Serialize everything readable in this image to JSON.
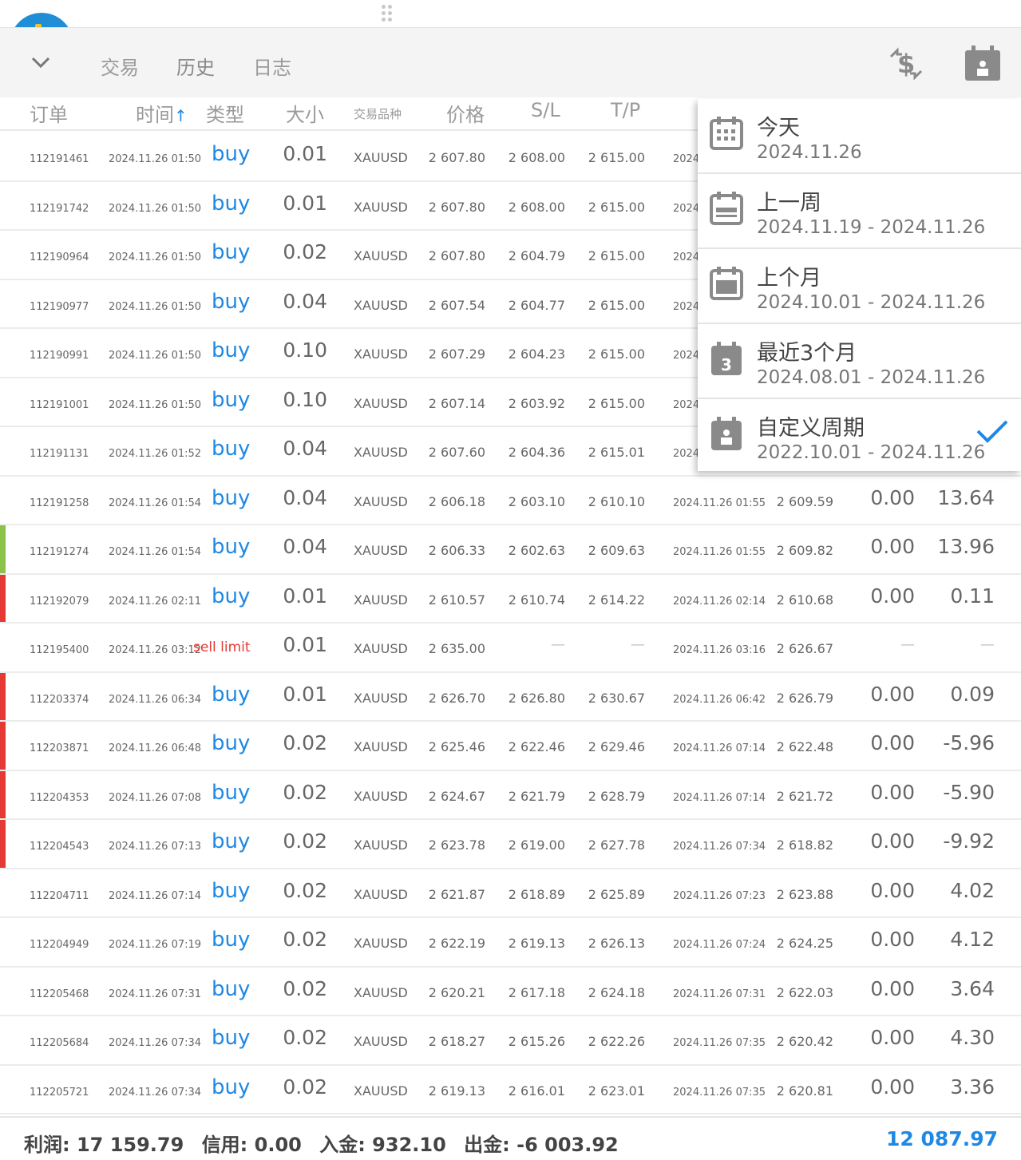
{
  "toolbar": {
    "tabs": [
      "交易",
      "历史",
      "日志"
    ]
  },
  "columns": {
    "order": "订单",
    "time": "时间",
    "type": "类型",
    "size": "大小",
    "symbol": "交易品种",
    "price": "价格",
    "sl": "S/L",
    "tp": "T/P"
  },
  "rows": [
    {
      "order": "112191461",
      "time": "2024.11.26 01:50",
      "type": "buy",
      "size": "0.01",
      "symbol": "XAUUSD",
      "price": "2 607.80",
      "sl": "2 608.00",
      "tp": "2 615.00",
      "close_time": "2024",
      "close_price": "",
      "swap": "",
      "profit": "",
      "marker": ""
    },
    {
      "order": "112191742",
      "time": "2024.11.26 01:50",
      "type": "buy",
      "size": "0.01",
      "symbol": "XAUUSD",
      "price": "2 607.80",
      "sl": "2 608.00",
      "tp": "2 615.00",
      "close_time": "2024",
      "close_price": "",
      "swap": "",
      "profit": "",
      "marker": ""
    },
    {
      "order": "112190964",
      "time": "2024.11.26 01:50",
      "type": "buy",
      "size": "0.02",
      "symbol": "XAUUSD",
      "price": "2 607.80",
      "sl": "2 604.79",
      "tp": "2 615.00",
      "close_time": "2024",
      "close_price": "",
      "swap": "",
      "profit": "",
      "marker": ""
    },
    {
      "order": "112190977",
      "time": "2024.11.26 01:50",
      "type": "buy",
      "size": "0.04",
      "symbol": "XAUUSD",
      "price": "2 607.54",
      "sl": "2 604.77",
      "tp": "2 615.00",
      "close_time": "2024",
      "close_price": "",
      "swap": "",
      "profit": "",
      "marker": ""
    },
    {
      "order": "112190991",
      "time": "2024.11.26 01:50",
      "type": "buy",
      "size": "0.10",
      "symbol": "XAUUSD",
      "price": "2 607.29",
      "sl": "2 604.23",
      "tp": "2 615.00",
      "close_time": "2024",
      "close_price": "",
      "swap": "",
      "profit": "",
      "marker": ""
    },
    {
      "order": "112191001",
      "time": "2024.11.26 01:50",
      "type": "buy",
      "size": "0.10",
      "symbol": "XAUUSD",
      "price": "2 607.14",
      "sl": "2 603.92",
      "tp": "2 615.00",
      "close_time": "2024",
      "close_price": "",
      "swap": "",
      "profit": "",
      "marker": ""
    },
    {
      "order": "112191131",
      "time": "2024.11.26 01:52",
      "type": "buy",
      "size": "0.04",
      "symbol": "XAUUSD",
      "price": "2 607.60",
      "sl": "2 604.36",
      "tp": "2 615.01",
      "close_time": "2024",
      "close_price": "",
      "swap": "",
      "profit": "",
      "marker": ""
    },
    {
      "order": "112191258",
      "time": "2024.11.26 01:54",
      "type": "buy",
      "size": "0.04",
      "symbol": "XAUUSD",
      "price": "2 606.18",
      "sl": "2 603.10",
      "tp": "2 610.10",
      "close_time": "2024.11.26 01:55",
      "close_price": "2 609.59",
      "swap": "0.00",
      "profit": "13.64",
      "marker": ""
    },
    {
      "order": "112191274",
      "time": "2024.11.26 01:54",
      "type": "buy",
      "size": "0.04",
      "symbol": "XAUUSD",
      "price": "2 606.33",
      "sl": "2 602.63",
      "tp": "2 609.63",
      "close_time": "2024.11.26 01:55",
      "close_price": "2 609.82",
      "swap": "0.00",
      "profit": "13.96",
      "marker": "#8bc34a"
    },
    {
      "order": "112192079",
      "time": "2024.11.26 02:11",
      "type": "buy",
      "size": "0.01",
      "symbol": "XAUUSD",
      "price": "2 610.57",
      "sl": "2 610.74",
      "tp": "2 614.22",
      "close_time": "2024.11.26 02:14",
      "close_price": "2 610.68",
      "swap": "0.00",
      "profit": "0.11",
      "marker": "#e53935"
    },
    {
      "order": "112195400",
      "time": "2024.11.26 03:12",
      "type": "sell limit",
      "size": "0.01",
      "symbol": "XAUUSD",
      "price": "2 635.00",
      "sl": "—",
      "tp": "—",
      "close_time": "2024.11.26 03:16",
      "close_price": "2 626.67",
      "swap": "—",
      "profit": "—",
      "marker": ""
    },
    {
      "order": "112203374",
      "time": "2024.11.26 06:34",
      "type": "buy",
      "size": "0.01",
      "symbol": "XAUUSD",
      "price": "2 626.70",
      "sl": "2 626.80",
      "tp": "2 630.67",
      "close_time": "2024.11.26 06:42",
      "close_price": "2 626.79",
      "swap": "0.00",
      "profit": "0.09",
      "marker": "#e53935"
    },
    {
      "order": "112203871",
      "time": "2024.11.26 06:48",
      "type": "buy",
      "size": "0.02",
      "symbol": "XAUUSD",
      "price": "2 625.46",
      "sl": "2 622.46",
      "tp": "2 629.46",
      "close_time": "2024.11.26 07:14",
      "close_price": "2 622.48",
      "swap": "0.00",
      "profit": "-5.96",
      "marker": "#e53935"
    },
    {
      "order": "112204353",
      "time": "2024.11.26 07:08",
      "type": "buy",
      "size": "0.02",
      "symbol": "XAUUSD",
      "price": "2 624.67",
      "sl": "2 621.79",
      "tp": "2 628.79",
      "close_time": "2024.11.26 07:14",
      "close_price": "2 621.72",
      "swap": "0.00",
      "profit": "-5.90",
      "marker": "#e53935"
    },
    {
      "order": "112204543",
      "time": "2024.11.26 07:13",
      "type": "buy",
      "size": "0.02",
      "symbol": "XAUUSD",
      "price": "2 623.78",
      "sl": "2 619.00",
      "tp": "2 627.78",
      "close_time": "2024.11.26 07:34",
      "close_price": "2 618.82",
      "swap": "0.00",
      "profit": "-9.92",
      "marker": "#e53935"
    },
    {
      "order": "112204711",
      "time": "2024.11.26 07:14",
      "type": "buy",
      "size": "0.02",
      "symbol": "XAUUSD",
      "price": "2 621.87",
      "sl": "2 618.89",
      "tp": "2 625.89",
      "close_time": "2024.11.26 07:23",
      "close_price": "2 623.88",
      "swap": "0.00",
      "profit": "4.02",
      "marker": ""
    },
    {
      "order": "112204949",
      "time": "2024.11.26 07:19",
      "type": "buy",
      "size": "0.02",
      "symbol": "XAUUSD",
      "price": "2 622.19",
      "sl": "2 619.13",
      "tp": "2 626.13",
      "close_time": "2024.11.26 07:24",
      "close_price": "2 624.25",
      "swap": "0.00",
      "profit": "4.12",
      "marker": ""
    },
    {
      "order": "112205468",
      "time": "2024.11.26 07:31",
      "type": "buy",
      "size": "0.02",
      "symbol": "XAUUSD",
      "price": "2 620.21",
      "sl": "2 617.18",
      "tp": "2 624.18",
      "close_time": "2024.11.26 07:31",
      "close_price": "2 622.03",
      "swap": "0.00",
      "profit": "3.64",
      "marker": ""
    },
    {
      "order": "112205684",
      "time": "2024.11.26 07:34",
      "type": "buy",
      "size": "0.02",
      "symbol": "XAUUSD",
      "price": "2 618.27",
      "sl": "2 615.26",
      "tp": "2 622.26",
      "close_time": "2024.11.26 07:35",
      "close_price": "2 620.42",
      "swap": "0.00",
      "profit": "4.30",
      "marker": ""
    },
    {
      "order": "112205721",
      "time": "2024.11.26 07:34",
      "type": "buy",
      "size": "0.02",
      "symbol": "XAUUSD",
      "price": "2 619.13",
      "sl": "2 616.01",
      "tp": "2 623.01",
      "close_time": "2024.11.26 07:35",
      "close_price": "2 620.81",
      "swap": "0.00",
      "profit": "3.36",
      "marker": ""
    }
  ],
  "footer": {
    "profit": "利润: 17 159.79",
    "credit": "信用: 0.00",
    "deposit": "入金: 932.10",
    "withdrawal": "出金: -6 003.92",
    "balance": "12 087.97"
  },
  "period_menu": {
    "items": [
      {
        "title": "今天",
        "range": "2024.11.26",
        "icon": "calendar-grid-icon"
      },
      {
        "title": "上一周",
        "range": "2024.11.19 - 2024.11.26",
        "icon": "calendar-week-icon"
      },
      {
        "title": "上个月",
        "range": "2024.10.01 - 2024.11.26",
        "icon": "calendar-month-icon"
      },
      {
        "title": "最近3个月",
        "range": "2024.08.01 - 2024.11.26",
        "icon": "calendar-3-icon"
      },
      {
        "title": "自定义周期",
        "range": "2022.10.01 - 2024.11.26",
        "icon": "calendar-custom-icon",
        "selected": true
      }
    ]
  },
  "colors": {
    "accent": "#1e88e5",
    "loss_marker": "#e53935",
    "profit_marker": "#8bc34a",
    "sell": "#e53935"
  }
}
